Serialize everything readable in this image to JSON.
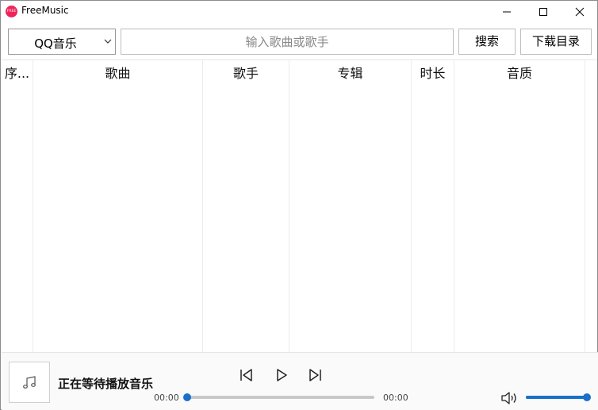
{
  "app": {
    "logo_text": "FREE",
    "title": "FreeMusic"
  },
  "toolbar": {
    "source_selected": "QQ音乐",
    "search_placeholder": "输入歌曲或歌手",
    "search_label": "搜索",
    "download_dir_label": "下载目录"
  },
  "table": {
    "columns": [
      "序...",
      "歌曲",
      "歌手",
      "专辑",
      "时长",
      "音质"
    ],
    "rows": []
  },
  "player": {
    "now_playing": "正在等待播放音乐",
    "time_current": "00:00",
    "time_total": "00:00",
    "progress": 0.0,
    "volume": 1.0,
    "accent_color": "#1a6fc9"
  },
  "icons": {
    "minimize": "minimize-icon",
    "maximize": "maximize-icon",
    "close": "close-icon",
    "dropdown": "chevron-down-icon",
    "cover": "music-note-icon",
    "prev": "skip-previous-icon",
    "play": "play-icon",
    "next": "skip-next-icon",
    "volume": "volume-icon"
  }
}
